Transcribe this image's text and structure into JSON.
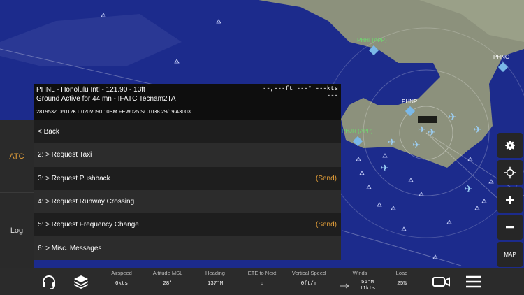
{
  "map": {
    "labels": {
      "phhi": "PHHI (APP)",
      "phng": "PHNG",
      "phnp": "PHNP",
      "phjr": "PHJR (APP)"
    }
  },
  "left_rail": {
    "atc_label": "ATC",
    "log_label": "Log"
  },
  "atc": {
    "station": "PHNL - Honolulu Intl - 121.90 - 13ft",
    "status": "Ground Active for 44 mn - IFATC Tecnam2TA",
    "metar": "281953Z 06012KT 020V090 10SM FEW025 SCT038 29/19 A3003",
    "readout_top": "--,---ft  ---° ---kts",
    "readout_bottom": "---",
    "menu": [
      {
        "label": "< Back",
        "action": ""
      },
      {
        "label": "2: > Request Taxi",
        "action": ""
      },
      {
        "label": "3: > Request Pushback",
        "action": "(Send)"
      },
      {
        "label": "4: > Request Runway Crossing",
        "action": ""
      },
      {
        "label": "5: > Request Frequency Change",
        "action": "(Send)"
      },
      {
        "label": "6: > Misc. Messages",
        "action": ""
      }
    ]
  },
  "right_toolbar": {
    "map_label": "MAP"
  },
  "bottom_bar": {
    "stats": [
      {
        "label": "Airspeed",
        "value": "0kts"
      },
      {
        "label": "Altitude MSL",
        "value": "28'"
      },
      {
        "label": "Heading",
        "value": "137°M"
      },
      {
        "label": "ETE to Next",
        "value": "__:__"
      },
      {
        "label": "Vertical Speed",
        "value": "0ft/m"
      },
      {
        "label": "Winds",
        "value": "56°M",
        "value2": "11kts"
      },
      {
        "label": "Load",
        "value": "25%"
      }
    ]
  },
  "colors": {
    "accent": "#e8a23a",
    "map_water": "#1b2a8a",
    "map_land": "#8a8f7a",
    "atc_label": "#6fd86f"
  }
}
